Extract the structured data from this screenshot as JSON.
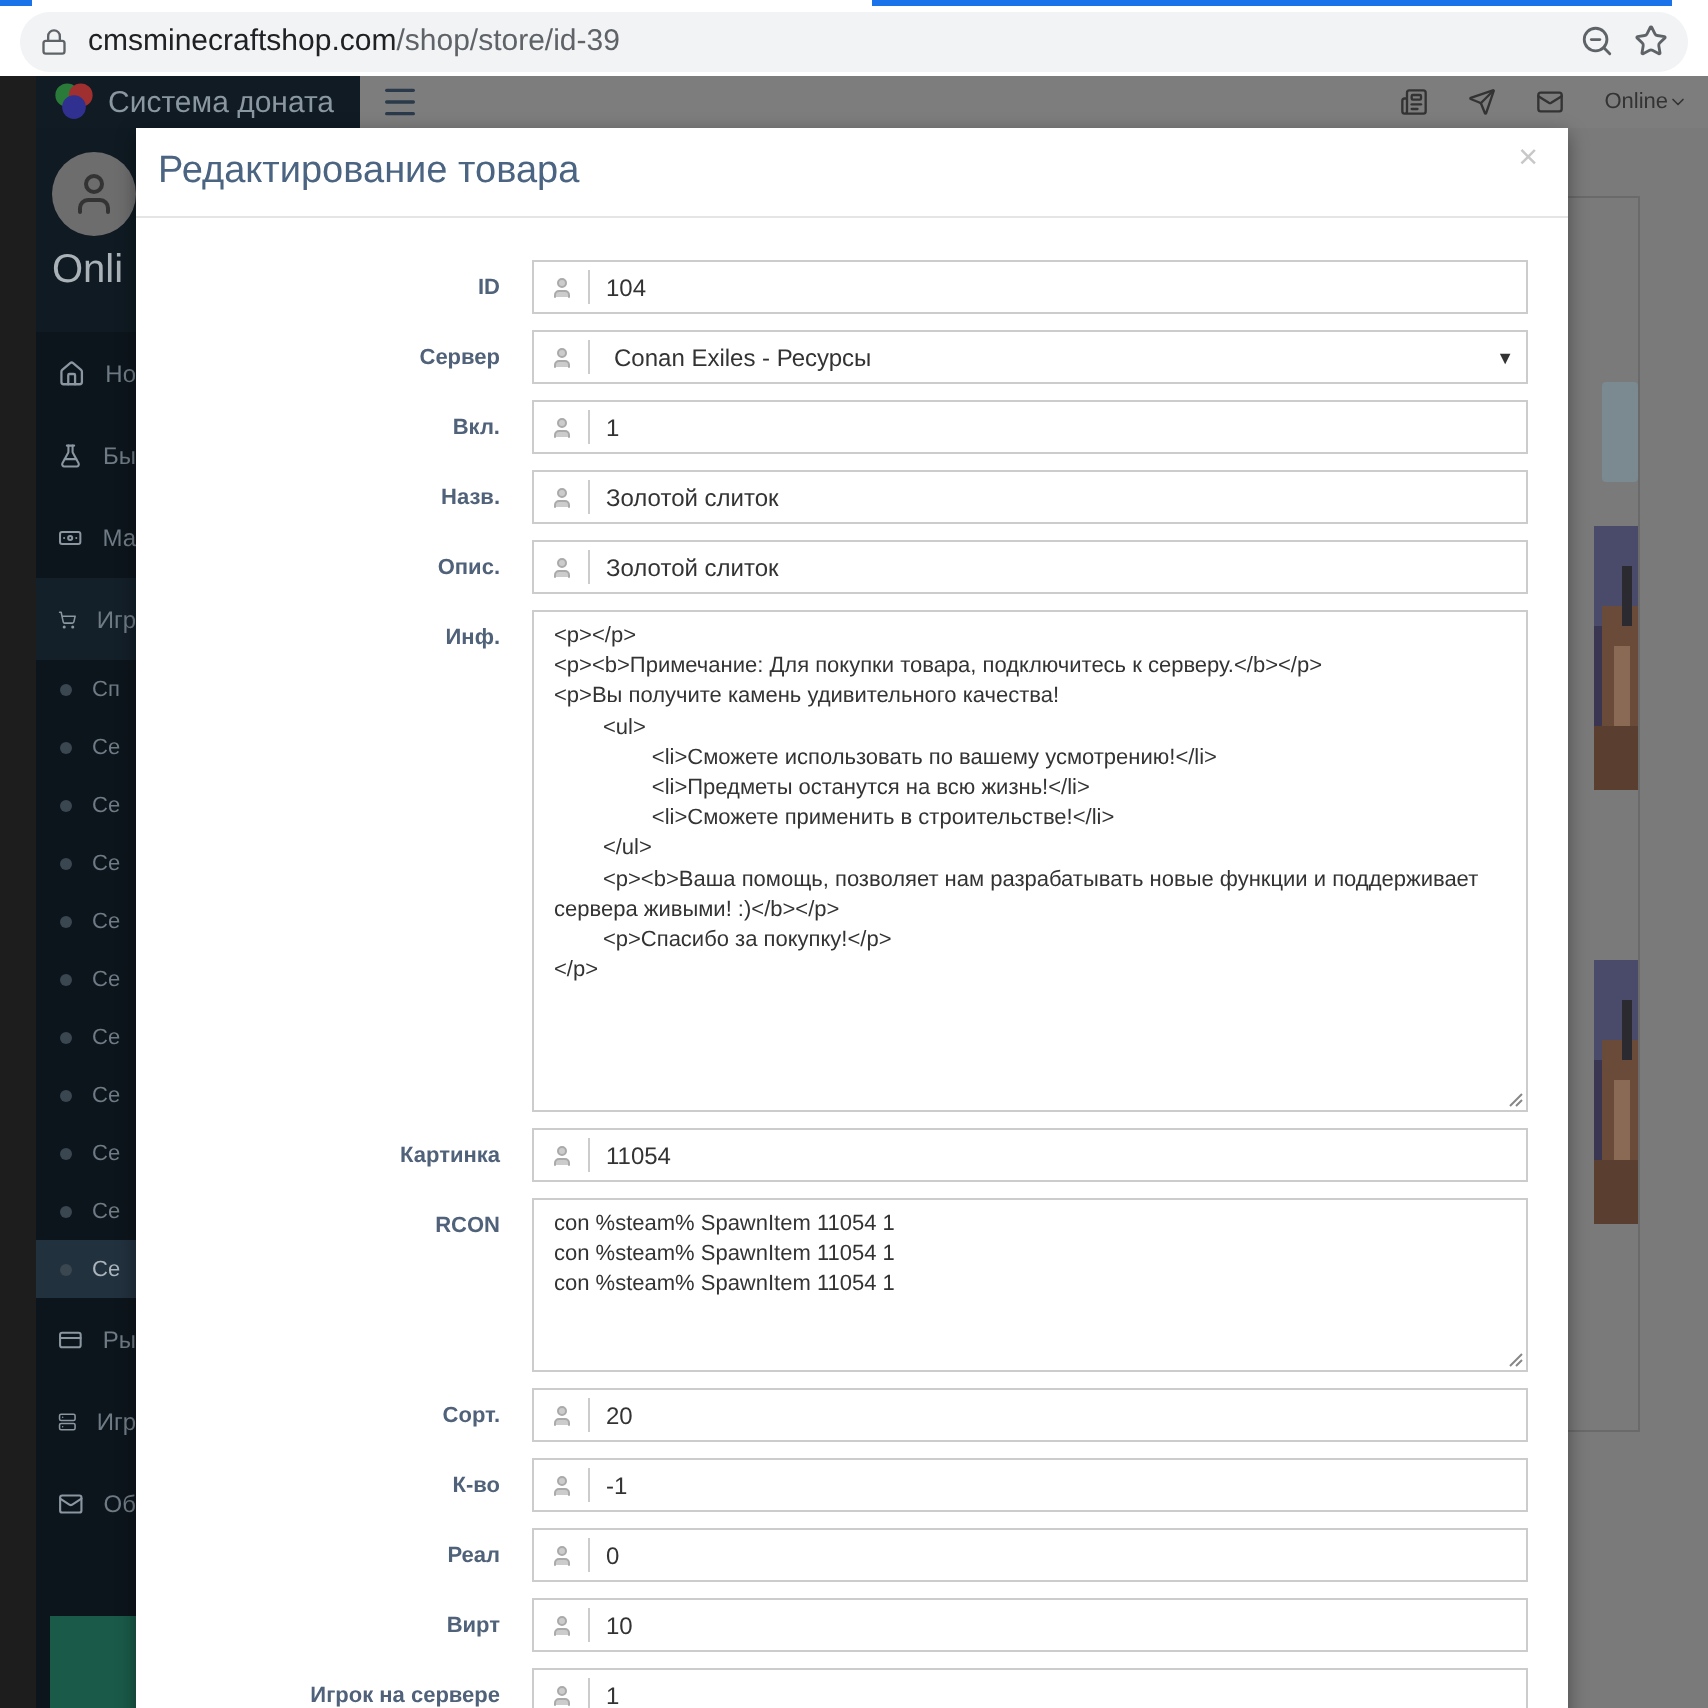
{
  "browser": {
    "domain": "cmsminecraftshop.com",
    "path": "/shop/store/id-39"
  },
  "sidebar": {
    "brand": "Система доната",
    "user": "Onli",
    "items": [
      {
        "label": "Но",
        "selected": false
      },
      {
        "label": "Бы",
        "selected": false
      },
      {
        "label": "Ма",
        "selected": false
      },
      {
        "label": "Игр",
        "selected": false,
        "expanded": true,
        "children": [
          {
            "label": "Сп",
            "selected": false
          },
          {
            "label": "Се",
            "selected": false
          },
          {
            "label": "Се",
            "selected": false
          },
          {
            "label": "Се",
            "selected": false
          },
          {
            "label": "Се",
            "selected": false
          },
          {
            "label": "Се",
            "selected": false
          },
          {
            "label": "Се",
            "selected": false
          },
          {
            "label": "Се",
            "selected": false
          },
          {
            "label": "Се",
            "selected": false
          },
          {
            "label": "Се",
            "selected": false
          },
          {
            "label": "Се",
            "selected": true
          }
        ]
      },
      {
        "label": "Ры",
        "selected": false
      },
      {
        "label": "Игр",
        "selected": false
      },
      {
        "label": "Об",
        "selected": false
      }
    ]
  },
  "header": {
    "status": "Online"
  },
  "modal": {
    "title": "Редактирование товара",
    "close": "×",
    "fields": [
      {
        "label": "ID",
        "kind": "text",
        "value": "104"
      },
      {
        "label": "Сервер",
        "kind": "select",
        "value": "Conan Exiles - Ресурсы",
        "arrow": "▼"
      },
      {
        "label": "Вкл.",
        "kind": "text",
        "value": "1"
      },
      {
        "label": "Назв.",
        "kind": "text",
        "value": "Золотой слиток"
      },
      {
        "label": "Опис.",
        "kind": "text",
        "value": "Золотой слиток"
      },
      {
        "label": "Инф.",
        "kind": "editor",
        "value": "<p></p>\n<p><b>Примечание: Для покупки товара, подключитесь к серверу.</b></p>\n<p>Вы получите камень удивительного качества!\n\t<ul>\n\t\t<li>Сможете использовать по вашему усмотрению!</li>\n\t\t<li>Предметы останутся на всю жизнь!</li>\n\t\t<li>Сможете применить в строительстве!</li>\n\t</ul>\n\t<p><b>Ваша помощь, позволяет нам разрабатывать новые функции и поддерживает сервера живыми! :)</b></p>\n\t<p>Спасибо за покупку!</p>\n</p>"
      },
      {
        "label": "Картинка",
        "kind": "text",
        "value": "11054"
      },
      {
        "label": "RCON",
        "kind": "textarea",
        "value": "con %steam% SpawnItem 11054 1\ncon %steam% SpawnItem 11054 1\ncon %steam% SpawnItem 11054 1"
      },
      {
        "label": "Сорт.",
        "kind": "text",
        "value": "20"
      },
      {
        "label": "К-во",
        "kind": "text",
        "value": "-1"
      },
      {
        "label": "Реал",
        "kind": "text",
        "value": "0"
      },
      {
        "label": "Вирт",
        "kind": "text",
        "value": "10"
      },
      {
        "label": "Игрок на сервере",
        "kind": "text",
        "value": "1"
      }
    ]
  }
}
